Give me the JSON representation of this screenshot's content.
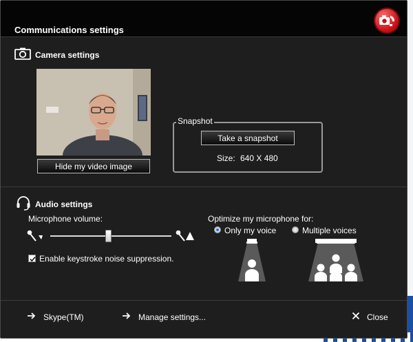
{
  "window": {
    "title": "Communications settings"
  },
  "camera": {
    "section_title": "Camera settings",
    "hide_video_button": "Hide my video image",
    "snapshot": {
      "legend": "Snapshot",
      "take_button": "Take a snapshot",
      "size_label": "Size:",
      "size_value": "640 X 480"
    }
  },
  "audio": {
    "section_title": "Audio settings",
    "mic_volume_label": "Microphone volume:",
    "mic_volume_level": 0.48,
    "noise_suppression_label": "Enable keystroke noise suppression.",
    "noise_suppression_checked": true,
    "optimize_label": "Optimize my microphone for:",
    "options": [
      {
        "label": "Only my voice",
        "selected": true
      },
      {
        "label": "Multiple voices",
        "selected": false
      }
    ]
  },
  "footer": {
    "skype_link": "Skype(TM)",
    "manage_link": "Manage settings...",
    "close_label": "Close"
  },
  "icons": {
    "brand": "camera-phone-icon",
    "camera": "camera-icon",
    "headset": "headset-icon",
    "mic_low": "microphone-low-icon",
    "mic_high": "microphone-high-icon",
    "single_speaker": "single-speaker-icon",
    "group_speakers": "group-speakers-icon",
    "arrow": "arrow-right-icon",
    "close": "close-icon"
  },
  "colors": {
    "accent": "#2a6fd6",
    "brand": "#c40d12",
    "background": "#1e1e1e",
    "titlebar": "#050505"
  }
}
